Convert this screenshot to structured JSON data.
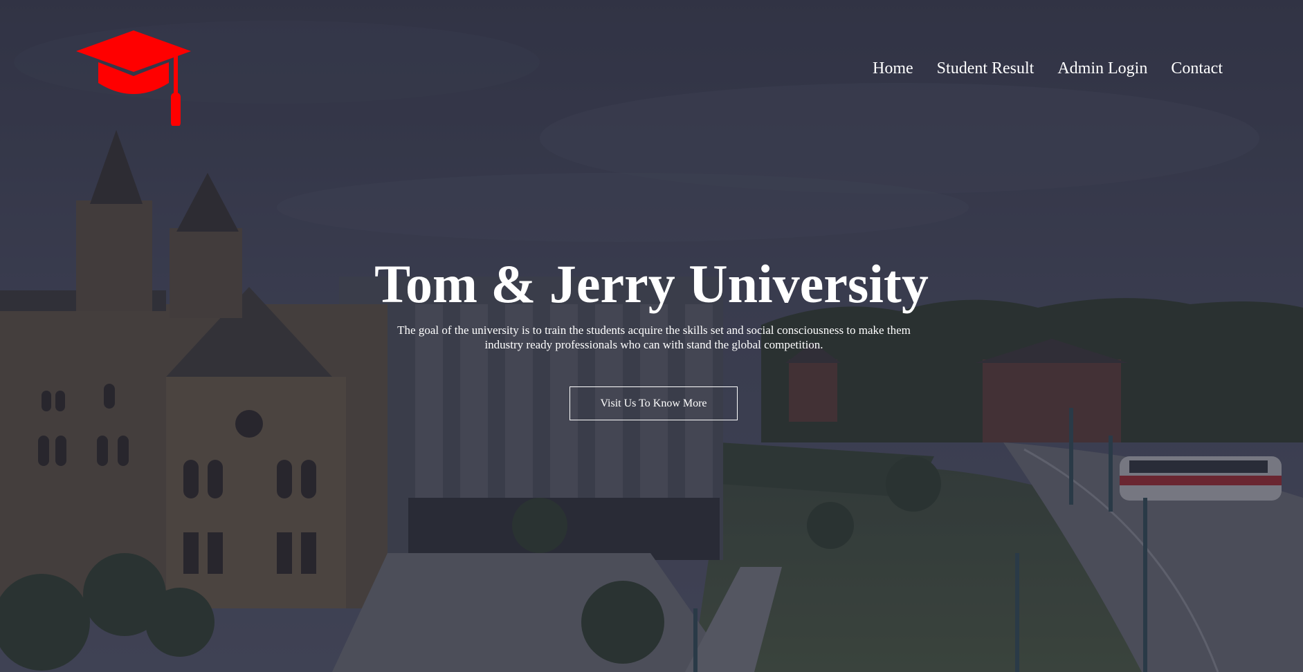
{
  "brand": {
    "logo_icon": "graduation-cap-icon",
    "logo_color": "#ff0000"
  },
  "nav": {
    "items": [
      {
        "label": "Home"
      },
      {
        "label": "Student Result"
      },
      {
        "label": "Admin Login"
      },
      {
        "label": "Contact"
      }
    ]
  },
  "hero": {
    "title": "Tom & Jerry University",
    "description": "The goal of the university is to train the students acquire the skills set and social consciousness to make them industry ready professionals who can with stand the global competition.",
    "cta_label": "Visit Us To Know More",
    "background": "campus-aerial-photo",
    "overlay_color": "#26283a"
  }
}
